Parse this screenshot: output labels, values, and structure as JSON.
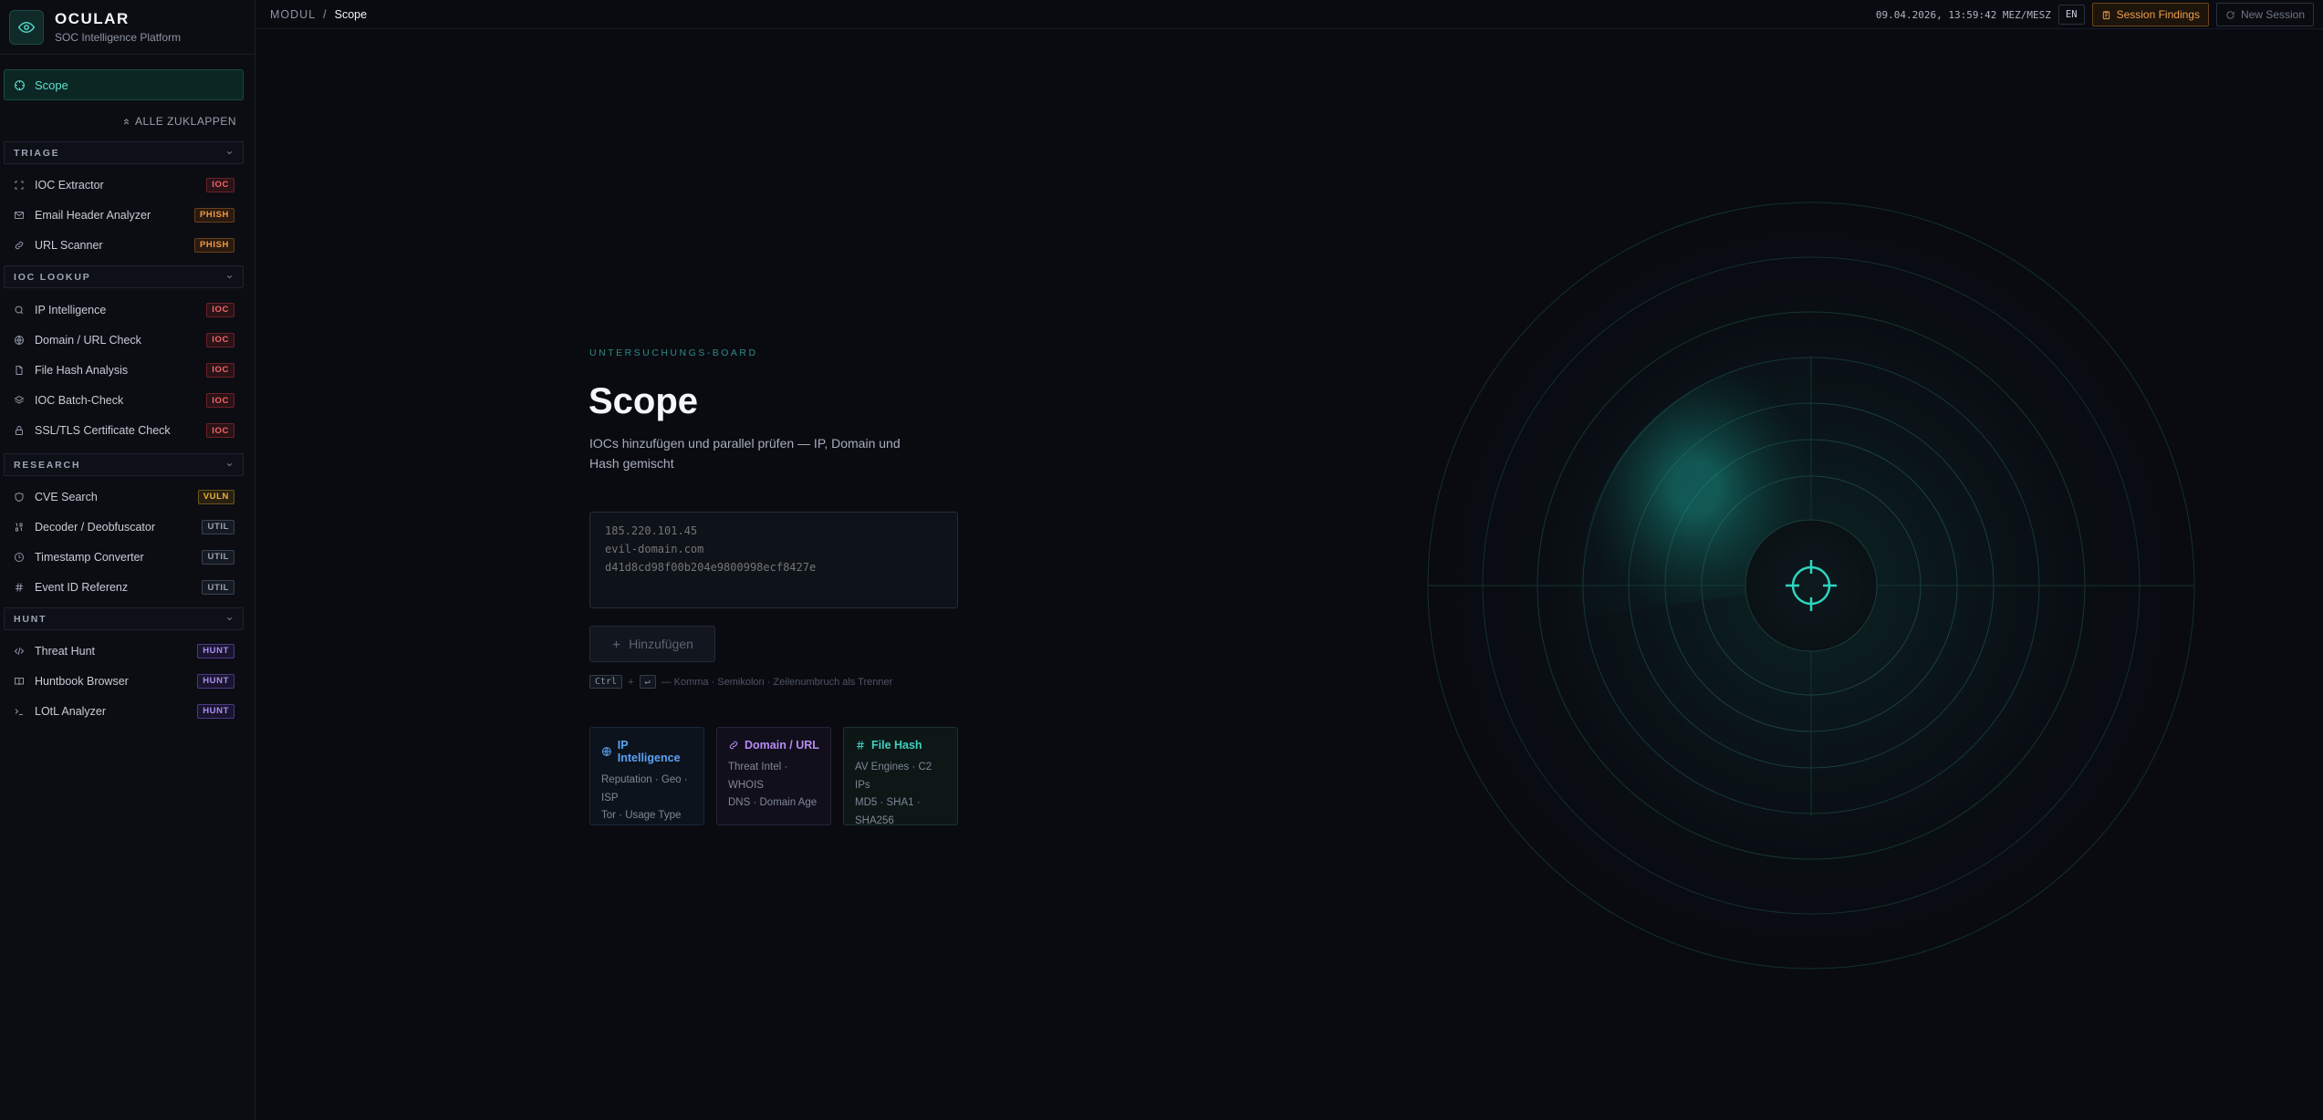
{
  "brand": {
    "title": "OCULAR",
    "subtitle": "SOC Intelligence Platform",
    "icon": "eye-icon"
  },
  "sidebar": {
    "active_item": {
      "label": "Scope",
      "icon": "crosshair-icon"
    },
    "collapse_all": "ALLE ZUKLAPPEN",
    "groups": [
      {
        "label": "TRIAGE",
        "items": [
          {
            "label": "IOC Extractor",
            "badge": "IOC",
            "icon": "scan-icon"
          },
          {
            "label": "Email Header Analyzer",
            "badge": "PHISH",
            "icon": "mail-icon"
          },
          {
            "label": "URL Scanner",
            "badge": "PHISH",
            "icon": "link-icon"
          }
        ]
      },
      {
        "label": "IOC LOOKUP",
        "items": [
          {
            "label": "IP Intelligence",
            "badge": "IOC",
            "icon": "search-icon"
          },
          {
            "label": "Domain / URL Check",
            "badge": "IOC",
            "icon": "globe-icon"
          },
          {
            "label": "File Hash Analysis",
            "badge": "IOC",
            "icon": "file-icon"
          },
          {
            "label": "IOC Batch-Check",
            "badge": "IOC",
            "icon": "layers-icon"
          },
          {
            "label": "SSL/TLS Certificate Check",
            "badge": "IOC",
            "icon": "lock-icon"
          }
        ]
      },
      {
        "label": "RESEARCH",
        "items": [
          {
            "label": "CVE Search",
            "badge": "VULN",
            "icon": "shield-icon"
          },
          {
            "label": "Decoder / Deobfuscator",
            "badge": "UTIL",
            "icon": "binary-icon"
          },
          {
            "label": "Timestamp Converter",
            "badge": "UTIL",
            "icon": "clock-icon"
          },
          {
            "label": "Event ID Referenz",
            "badge": "UTIL",
            "icon": "hash-icon"
          }
        ]
      },
      {
        "label": "HUNT",
        "items": [
          {
            "label": "Threat Hunt",
            "badge": "HUNT",
            "icon": "code-icon"
          },
          {
            "label": "Huntbook Browser",
            "badge": "HUNT",
            "icon": "book-icon"
          },
          {
            "label": "LOtL Analyzer",
            "badge": "HUNT",
            "icon": "terminal-icon"
          }
        ]
      }
    ]
  },
  "topbar": {
    "breadcrumb_root": "MODUL",
    "breadcrumb_sep": "/",
    "breadcrumb_current": "Scope",
    "datetime": "09.04.2026, 13:59:42 MEZ/MESZ",
    "language": "EN",
    "session_findings": "Session Findings",
    "new_session": "New Session"
  },
  "main": {
    "eyebrow": "UNTERSUCHUNGS-BOARD",
    "title": "Scope",
    "subtitle": "IOCs hinzufügen und parallel prüfen — IP, Domain und Hash gemischt",
    "input_placeholder": "185.220.101.45\nevil-domain.com\nd41d8cd98f00b204e9800998ecf8427e",
    "add_button": "Hinzufügen",
    "hint_key1": "Ctrl",
    "hint_plus": "+",
    "hint_key2": "↵",
    "hint_text": "— Komma · Semikolon · Zeilenumbruch als Trenner",
    "cards": [
      {
        "title": "IP Intelligence",
        "desc": "Reputation · Geo · ISP\nTor · Usage Type",
        "icon": "globe-icon"
      },
      {
        "title": "Domain / URL",
        "desc": "Threat Intel · WHOIS\nDNS · Domain Age",
        "icon": "link-icon"
      },
      {
        "title": "File Hash",
        "desc": "AV Engines · C2 IPs\nMD5 · SHA1 · SHA256",
        "icon": "hash-icon"
      }
    ]
  },
  "colors": {
    "accent": "#2dd4bf",
    "ioc": "#f06767",
    "phish": "#f29a46",
    "vuln": "#e8b53c",
    "util": "#9aa3b3",
    "hunt": "#a88ff0"
  }
}
